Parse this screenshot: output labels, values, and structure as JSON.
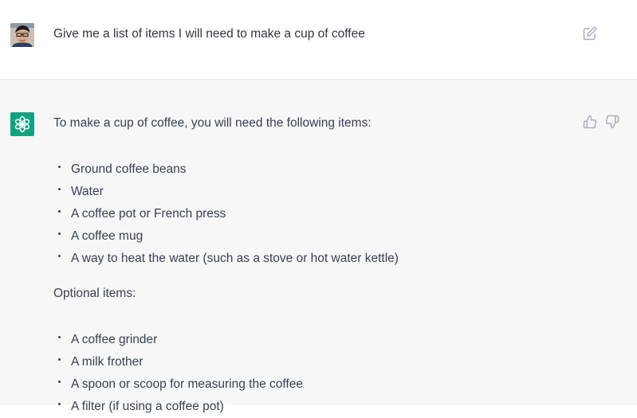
{
  "user_message": {
    "text": "Give me a list of items I will need to make a cup of coffee"
  },
  "assistant_message": {
    "intro": "To make a cup of coffee, you will need the following items:",
    "required_items": [
      "Ground coffee beans",
      "Water",
      "A coffee pot or French press",
      "A coffee mug",
      "A way to heat the water (such as a stove or hot water kettle)"
    ],
    "optional_heading": "Optional items:",
    "optional_items": [
      "A coffee grinder",
      "A milk frother",
      "A spoon or scoop for measuring the coffee",
      "A filter (if using a coffee pot)"
    ]
  },
  "icons": {
    "user_avatar": "user-avatar-photo",
    "bot_avatar": "openai-logo-icon",
    "edit": "edit-icon",
    "thumbs_up": "thumbs-up-icon",
    "thumbs_down": "thumbs-down-icon"
  },
  "colors": {
    "bot_avatar_bg": "#10a37f",
    "assistant_bg": "#f7f7f8",
    "text": "#374151",
    "icon": "#acacbe"
  }
}
